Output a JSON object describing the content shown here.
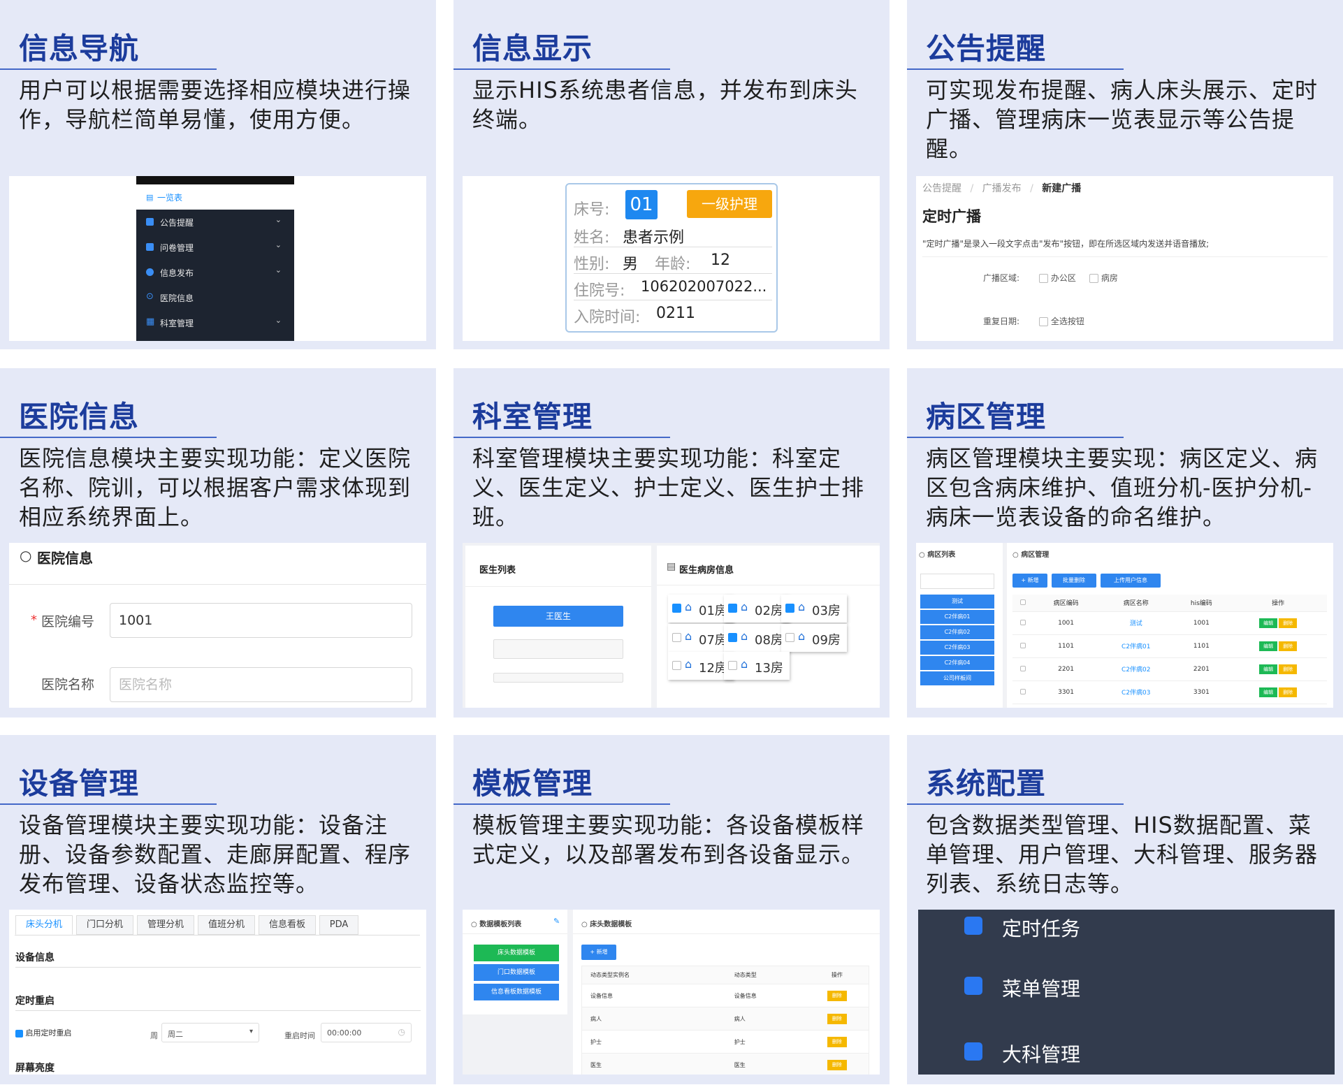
{
  "cards": [
    {
      "title": "信息导航",
      "desc": "用户可以根据需要选择相应模块进行操作，导航栏简单易懂，使用方便。",
      "nav": {
        "first": "一览表",
        "items": [
          "公告提醒",
          "问卷管理",
          "信息发布",
          "医院信息",
          "科室管理"
        ]
      }
    },
    {
      "title": "信息显示",
      "desc": "显示HIS系统患者信息，并发布到床头终端。",
      "bed": {
        "bed_label": "床号:",
        "bed_no": "01",
        "level": "一级护理",
        "name_label": "姓名:",
        "name": "患者示例",
        "sex_label": "性别:",
        "sex": "男",
        "age_label": "年龄:",
        "age": "12",
        "inpatient_label": "住院号:",
        "inpatient": "106202007022...",
        "admit_label": "入院时间:",
        "admit": "0211"
      }
    },
    {
      "title": "公告提醒",
      "desc": "可实现发布提醒、病人床头展示、定时广播、管理病床一览表显示等公告提醒。",
      "form": {
        "crumbs": [
          "公告提醒",
          "广播发布",
          "新建广播"
        ],
        "heading": "定时广播",
        "note": "\"定时广播\"是录入一段文字点击\"发布\"按钮，即在所选区域内发送并语音播放;",
        "area_label": "广播区域:",
        "area_opts": [
          "办公区",
          "病房"
        ],
        "repeat_label": "重复日期:",
        "repeat_opt": "全选按钮"
      }
    },
    {
      "title": "医院信息",
      "desc": "医院信息模块主要实现功能：定义医院名称、院训，可以根据客户需求体现到相应系统界面上。",
      "hosp": {
        "panel_title": "医院信息",
        "code_label": "医院编号",
        "code_value": "1001",
        "name_label": "医院名称",
        "name_placeholder": "医院名称"
      }
    },
    {
      "title": "科室管理",
      "desc": "科室管理模块主要实现功能：科室定义、医生定义、护士定义、医生护士排班。",
      "dept": {
        "list_title": "医生列表",
        "doctor": "王医生",
        "room_title": "医生病房信息",
        "rooms": [
          "01房",
          "02房",
          "03房",
          "07房",
          "08房",
          "09房",
          "12房",
          "13房"
        ],
        "checked": [
          true,
          true,
          true,
          false,
          true,
          false,
          false,
          false
        ]
      }
    },
    {
      "title": "病区管理",
      "desc": "病区管理模块主要实现：病区定义、病区包含病床维护、值班分机-医护分机-病床一览表设备的命名维护。",
      "ward": {
        "list_title": "病区列表",
        "list": [
          "测试",
          "C2伴病01",
          "C2伴病02",
          "C2伴病03",
          "C2伴病04",
          "公司样板间"
        ],
        "panel_title": "病区管理",
        "btn_add": "+ 新增",
        "btn_batch": "批量删除",
        "btn_upload": "上传用户信息",
        "headers": [
          "病区编码",
          "病区名称",
          "his编码",
          "操作"
        ],
        "rows": [
          [
            "1001",
            "测试",
            "1001"
          ],
          [
            "1101",
            "C2伴病01",
            "1101"
          ],
          [
            "2201",
            "C2伴病02",
            "2201"
          ],
          [
            "3301",
            "C2伴病03",
            "3301"
          ]
        ],
        "edit": "编辑",
        "del": "删除"
      }
    },
    {
      "title": "设备管理",
      "desc": "设备管理模块主要实现功能：设备注册、设备参数配置、走廊屏配置、程序发布管理、设备状态监控等。",
      "dev": {
        "tabs": [
          "床头分机",
          "门口分机",
          "管理分机",
          "值班分机",
          "信息看板",
          "PDA"
        ],
        "sec1": "设备信息",
        "sec2": "定时重启",
        "enable": "启用定时重启",
        "week_label": "周",
        "week_value": "周二",
        "time_label": "重启时间",
        "time_value": "00:00:00",
        "sec3": "屏幕亮度"
      }
    },
    {
      "title": "模板管理",
      "desc": "模板管理主要实现功能：各设备模板样式定义，以及部署发布到各设备显示。",
      "tpl": {
        "list_title": "数据模板列表",
        "list": [
          "床头数据模板",
          "门口数据模板",
          "信息看板数据模板"
        ],
        "panel_title": "床头数据模板",
        "btn_add": "+ 新增",
        "headers": [
          "动态类型实例名",
          "动态类型",
          "操作"
        ],
        "rows": [
          [
            "设备信息",
            "设备信息"
          ],
          [
            "病人",
            "病人"
          ],
          [
            "护士",
            "护士"
          ],
          [
            "医生",
            "医生"
          ]
        ],
        "del": "删除"
      }
    },
    {
      "title": "系统配置",
      "desc": "包含数据类型管理、HIS数据配置、菜单管理、用户管理、大科管理、服务器列表、系统日志等。",
      "menu": [
        "定时任务",
        "菜单管理",
        "大科管理"
      ]
    }
  ]
}
